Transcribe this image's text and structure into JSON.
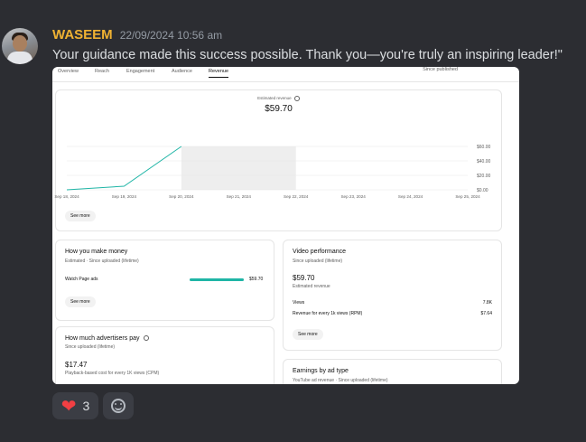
{
  "message": {
    "author": "WASEEM",
    "timestamp": "22/09/2024 10:56 am",
    "text": "Your guidance made this success possible. Thank you—you're truly an inspiring leader!\""
  },
  "screenshot": {
    "tabs": [
      "Overview",
      "Reach",
      "Engagement",
      "Audience",
      "Revenue"
    ],
    "active_tab": "Revenue",
    "period": "Since published",
    "revenue_card": {
      "label": "Estimated revenue",
      "value": "$59.70",
      "see_more": "See more"
    },
    "how_you_make_money": {
      "title": "How you make money",
      "subtitle": "Estimated · Since uploaded (lifetime)",
      "row_label": "Watch Page ads",
      "row_value": "$59.70",
      "row_fraction": 1.0,
      "see_more": "See more"
    },
    "video_performance": {
      "title": "Video performance",
      "subtitle": "Since uploaded (lifetime)",
      "value": "$59.70",
      "value_label": "Estimated revenue",
      "rows": [
        {
          "label": "Views",
          "value": "7.8K"
        },
        {
          "label": "Revenue for every 1k views (RPM)",
          "value": "$7.64"
        }
      ],
      "see_more": "See more"
    },
    "advertisers": {
      "title": "How much advertisers pay",
      "subtitle": "Since uploaded (lifetime)",
      "value": "$17.47",
      "value_label": "Playback-based cost for every 1K views (CPM)"
    },
    "ad_type": {
      "title": "Earnings by ad type",
      "subtitle": "YouTube ad revenue · Since uploaded (lifetime)"
    }
  },
  "chart_data": {
    "type": "line",
    "x": [
      "Sep 18, 2024",
      "Sep 19, 2024",
      "Sep 20, 2024",
      "Sep 21, 2024",
      "Sep 22, 2024",
      "Sep 23, 2024",
      "Sep 24, 2024",
      "Sep 25, 2024"
    ],
    "values": [
      0,
      5,
      60,
      null,
      null,
      null,
      null,
      null
    ],
    "yticks": [
      "$60.00",
      "$40.00",
      "$20.00",
      "$0.00"
    ],
    "ytick_values": [
      60,
      40,
      20,
      0
    ],
    "ylim": [
      0,
      60
    ],
    "shaded_range": [
      "Sep 20, 2024",
      "Sep 22, 2024"
    ],
    "line_color": "#1fb5a6",
    "shade_color": "#eeeeee",
    "grid": true
  },
  "reactions": [
    {
      "icon": "heart-icon",
      "count": "3"
    }
  ],
  "colors": {
    "author": "#f0b232",
    "background": "#2c2d32",
    "accent": "#1fb5a6"
  }
}
